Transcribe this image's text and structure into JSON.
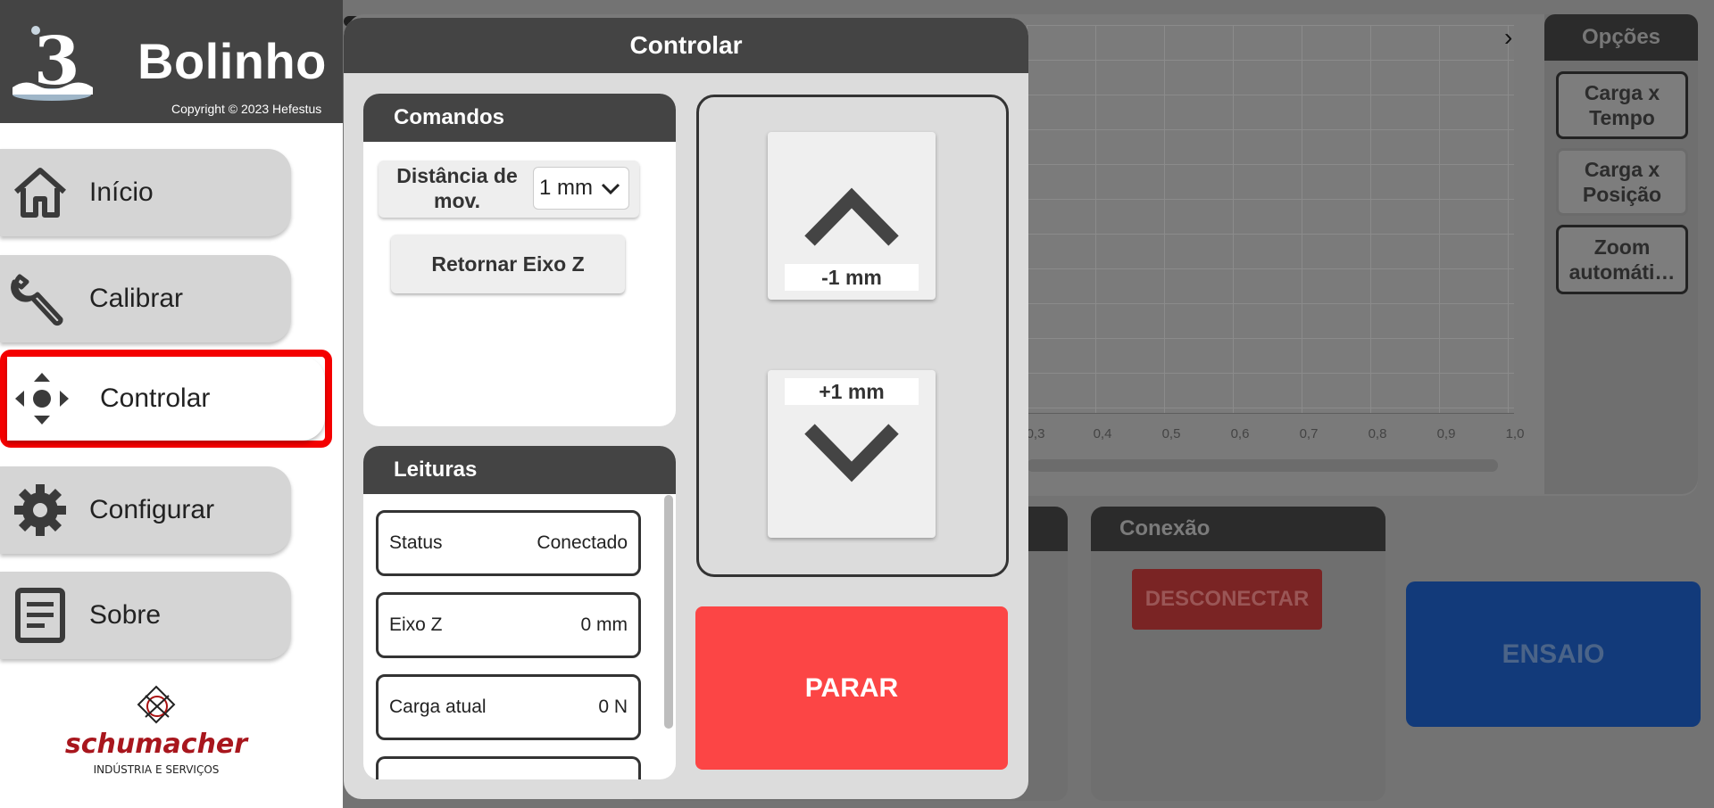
{
  "background_app": {
    "chart": {
      "x_ticks": [
        "0,3",
        "0,4",
        "0,5",
        "0,6",
        "0,7",
        "0,8",
        "0,9",
        "1,0"
      ]
    },
    "options": {
      "title": "Opções",
      "buttons": [
        "Carga x Tempo",
        "Carga x Posição",
        "Zoom automáti…"
      ]
    },
    "connection": {
      "title": "Conexão",
      "disconnect_label": "DESCONECTAR"
    },
    "ensaio_label": "ENSAIO"
  },
  "sidebar": {
    "brand": "Bolinho",
    "copyright": "Copyright © 2023 Hefestus",
    "items": [
      {
        "label": "Início",
        "icon": "home-icon"
      },
      {
        "label": "Calibrar",
        "icon": "wrench-icon"
      },
      {
        "label": "Controlar",
        "icon": "move-arrows-icon",
        "active": true
      },
      {
        "label": "Configurar",
        "icon": "gear-icon"
      },
      {
        "label": "Sobre",
        "icon": "document-icon"
      }
    ],
    "partner_logo": {
      "name": "schumacher",
      "tagline": "INDÚSTRIA E SERVIÇOS"
    }
  },
  "modal": {
    "title": "Controlar",
    "commands": {
      "title": "Comandos",
      "distance_label": "Distância de mov.",
      "distance_value": "1 mm",
      "return_z_label": "Retornar Eixo Z"
    },
    "readings": {
      "title": "Leituras",
      "rows": [
        {
          "label": "Status",
          "value": "Conectado"
        },
        {
          "label": "Eixo Z",
          "value": "0 mm"
        },
        {
          "label": "Carga atual",
          "value": "0 N"
        }
      ]
    },
    "jog": {
      "up_label": "-1 mm",
      "down_label": "+1 mm"
    },
    "stop_label": "PARAR"
  },
  "colors": {
    "header_dark": "#444444",
    "active_outline": "#f40000",
    "stop_button": "#fc4545",
    "ensaio_button": "#0a5ad6"
  }
}
